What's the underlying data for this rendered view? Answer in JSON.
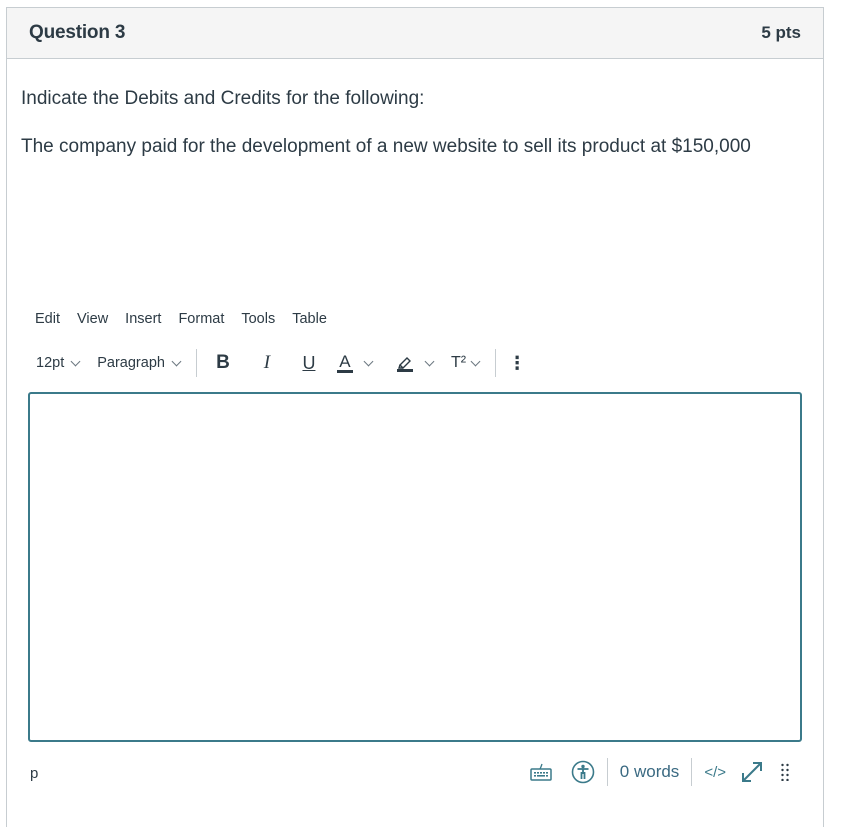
{
  "question": {
    "title": "Question 3",
    "points": "5 pts",
    "prompt": "Indicate the Debits and Credits for the following:",
    "detail": "The company paid for the development of a new website to sell its product at $150,000"
  },
  "editor": {
    "menu": [
      "Edit",
      "View",
      "Insert",
      "Format",
      "Tools",
      "Table"
    ],
    "toolbar": {
      "font_size": "12pt",
      "block_format": "Paragraph",
      "bold": "B",
      "italic": "I",
      "underline": "U",
      "text_color": "A",
      "superscript": "T²",
      "more": "⋮"
    },
    "content": "",
    "status": {
      "element_path": "p",
      "word_count": "0 words",
      "html_toggle": "</>"
    },
    "accent_color": "#3b7a8a"
  }
}
